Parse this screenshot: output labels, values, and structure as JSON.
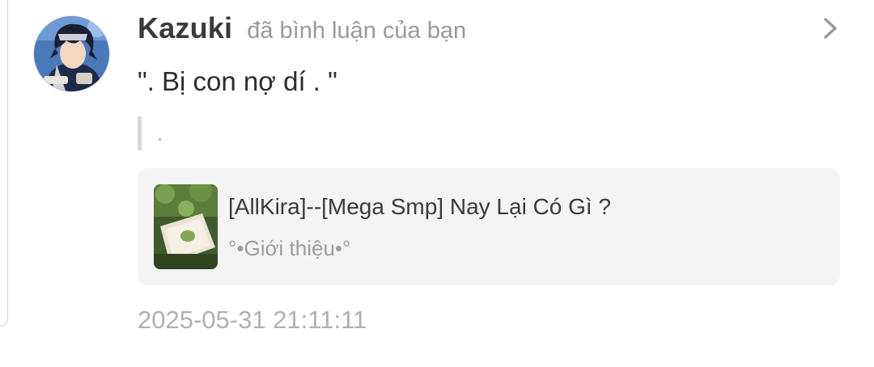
{
  "notification": {
    "user": {
      "name": "Kazuki",
      "avatar_icon": "user-avatar"
    },
    "action_text": "đã bình luận của bạn",
    "open_icon": "chevron-right-icon",
    "comment_text": "\". Bị con nợ dí . \"",
    "quoted_text": ".",
    "story": {
      "title": "[AllKira]--[Mega Smp] Nay Lại Có Gì ?",
      "subtitle": "°•Giới thiệu•°",
      "cover_icon": "story-cover-image"
    },
    "timestamp": "2025-05-31 21:11:11"
  },
  "colors": {
    "card_background": "#f4f4f4",
    "secondary_text": "#9a9a9a",
    "primary_text": "#2c2c2c"
  }
}
